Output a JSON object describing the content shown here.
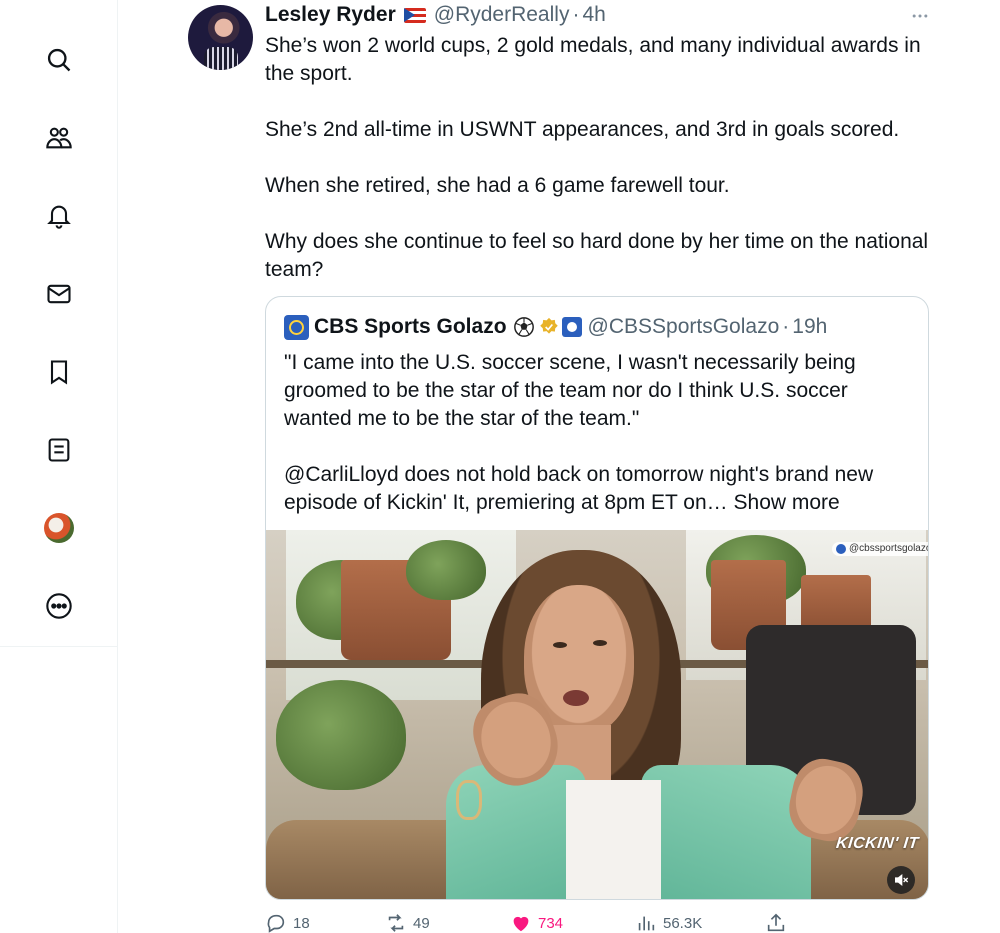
{
  "tweet": {
    "author_name": "Lesley Ryder",
    "author_handle": "@RyderReally",
    "separator": "·",
    "time": "4h",
    "text_paragraphs": [
      "She’s won 2 world cups, 2 gold medals, and many individual awards in the sport.",
      "She’s 2nd all-time in USWNT appearances, and 3rd in goals scored.",
      "When she retired, she had a 6 game farewell tour.",
      "Why does she continue to feel so hard done by her time on the national team?"
    ],
    "flag_icon": "puerto-rico-flag-icon",
    "more_icon": "more-horizontal-icon"
  },
  "quote": {
    "author_name": "CBS Sports Golazo",
    "author_handle": "@CBSSportsGolazo",
    "separator": "·",
    "time": "19h",
    "paragraph_1": "\"I came into the U.S. soccer scene, I wasn't necessarily being groomed to be the star of the team nor do I think U.S. soccer wanted me to be the star of the team.\"",
    "paragraph_2": "@CarliLloyd does not hold back on tomorrow night's brand new episode of Kickin' It, premiering at 8pm ET on…",
    "show_more": "Show more",
    "video": {
      "watermark": "@cbssportsgolazo",
      "logo_text": "KICKIN' IT"
    }
  },
  "metrics": {
    "replies": "18",
    "reposts": "49",
    "likes": "734",
    "views": "56.3K"
  },
  "sidebar": {
    "items": [
      "search",
      "communities",
      "notifications",
      "messages",
      "bookmarks",
      "lists",
      "profile",
      "more"
    ]
  },
  "colors": {
    "text": "#0f1419",
    "secondary": "#536471",
    "border": "#cfd9de",
    "like": "#f91880",
    "verified_gold": "#e8b32a"
  }
}
